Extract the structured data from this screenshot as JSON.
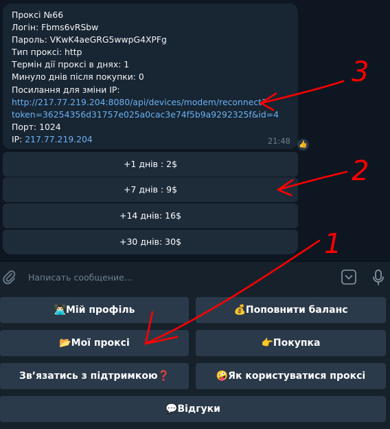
{
  "message": {
    "lines": [
      "Проксі №66",
      "Логін: Fbms6vRSbw",
      "Пароль: VKwK4aeGRG5wwpG4XPFg",
      "Тип проксі: http",
      "Термін дії проксі в днях: 1",
      "Минуло днів після покупки: 0",
      "Посилання для зміни IP:"
    ],
    "link_line1": "http://217.77.219.204:8080/api/devices/modem/reconnect?",
    "link_line2": "token=36254356d31757e025a0cac3e74f5b9a9292325f&id=4",
    "port": "Порт: 1024",
    "ip_label": "IP:",
    "ip_value": "217.77.219.204",
    "time": "21:48",
    "reaction": "👍"
  },
  "inline_buttons": [
    "+1 днів : 2$",
    "+7 днів : 9$",
    "+14 днів: 16$",
    "+30 днів: 30$"
  ],
  "input": {
    "placeholder": "Написать сообщение..."
  },
  "keyboard": {
    "profile": {
      "emoji": "👨🏻‍💻",
      "label": "Мій профіль"
    },
    "topup": {
      "emoji": "💰",
      "label": "Поповнити баланс"
    },
    "my_proxies": {
      "emoji": "📂",
      "label": "Мої проксі"
    },
    "purchase": {
      "emoji": "👉",
      "label": "Покупка"
    },
    "support": {
      "label": "Зв’язатись з підтримкою",
      "emoji": "❓"
    },
    "howto": {
      "emoji": "🤪",
      "label": "Як користуватися проксі"
    },
    "reviews": {
      "emoji": "💬",
      "label": "Відгуки"
    }
  },
  "annotations": {
    "n1": "1",
    "n2": "2",
    "n3": "3"
  },
  "colors": {
    "annotation": "#ff0000",
    "link": "#6ab3f3",
    "button": "#2b3a4a"
  }
}
